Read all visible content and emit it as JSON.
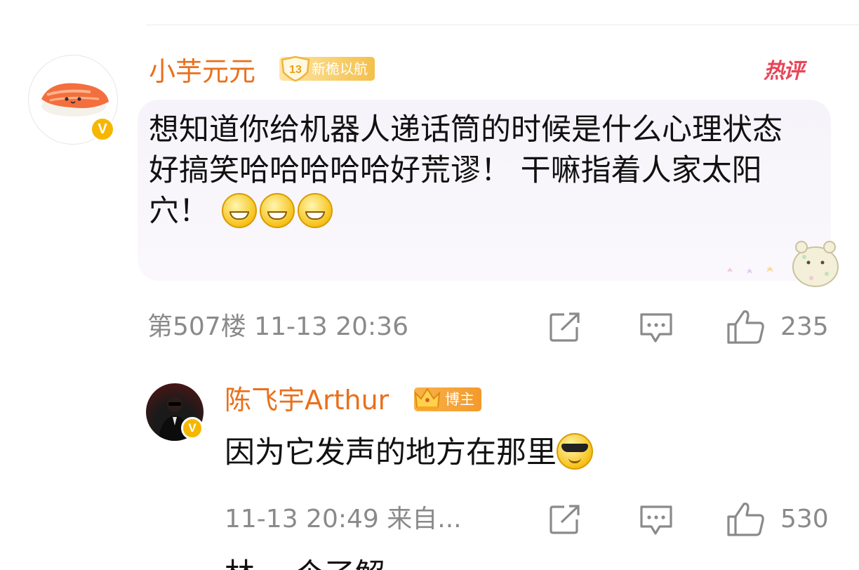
{
  "comment": {
    "username": "小芋元元",
    "level": "13",
    "level_tag": "新桅以航",
    "hot_tag": "热评",
    "text": "想知道你给机器人递话筒的时候是什么心理状态 好搞笑哈哈哈哈哈好荒谬！ 干嘛指着人家太阳穴！",
    "emoji_count": 3,
    "emoji": "grin-emoji",
    "floor": "第507楼",
    "timestamp": "11-13 20:36",
    "like_count": "235",
    "verified_badge": "V"
  },
  "reply": {
    "username": "陈飞宇Arthur",
    "badge_label": "博主",
    "text": "因为它发声的地方在那里",
    "emoji": "cool-emoji",
    "timestamp": "11-13 20:49",
    "source": "来自...",
    "like_count": "530",
    "verified_badge": "V"
  },
  "next_comment_partial": "林 一个了解",
  "colors": {
    "username": "#e9701d",
    "hot_tag": "#e8465a",
    "meta_text": "#8a8a8a",
    "badge_gold": "#f5b700"
  }
}
